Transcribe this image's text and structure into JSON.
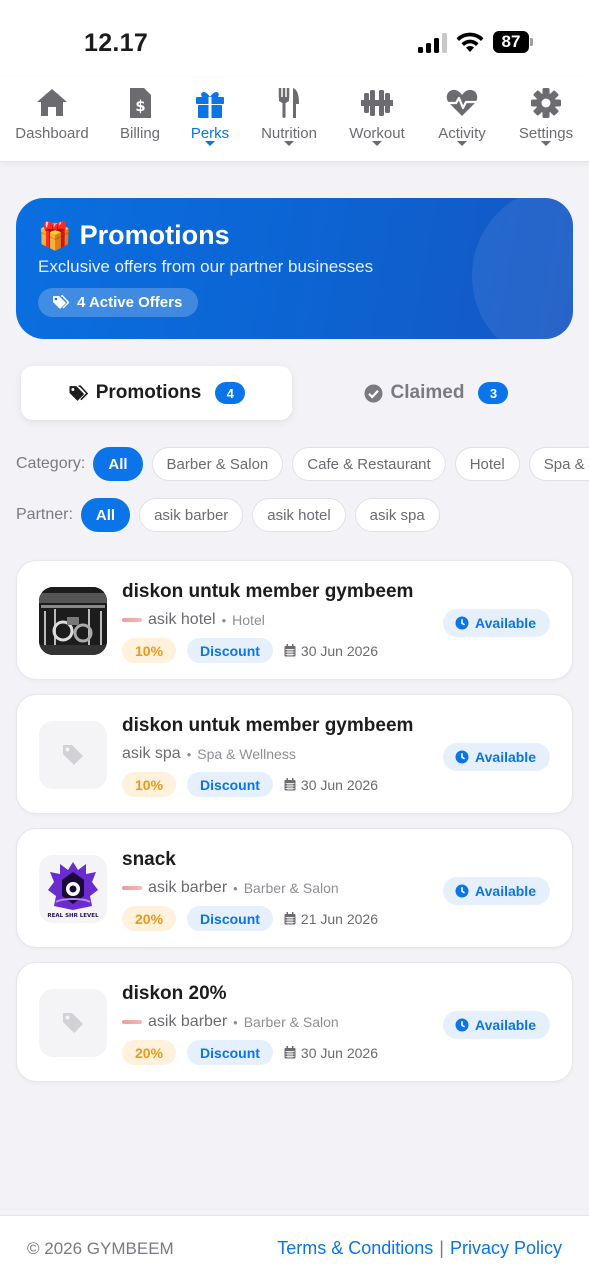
{
  "status_bar": {
    "time": "12.17",
    "battery": "87"
  },
  "nav": [
    {
      "label": "Dashboard",
      "icon": "home-icon",
      "active": false,
      "has_caret": false
    },
    {
      "label": "Billing",
      "icon": "invoice-icon",
      "active": false,
      "has_caret": false
    },
    {
      "label": "Perks",
      "icon": "gift-icon",
      "active": true,
      "has_caret": true
    },
    {
      "label": "Nutrition",
      "icon": "utensils-icon",
      "active": false,
      "has_caret": true
    },
    {
      "label": "Workout",
      "icon": "dumbbell-icon",
      "active": false,
      "has_caret": true
    },
    {
      "label": "Activity",
      "icon": "heart-pulse-icon",
      "active": false,
      "has_caret": true
    },
    {
      "label": "Settings",
      "icon": "gear-icon",
      "active": false,
      "has_caret": true
    }
  ],
  "hero": {
    "emoji": "🎁",
    "title": "Promotions",
    "subtitle": "Exclusive offers from our partner businesses",
    "badge": "4 Active Offers"
  },
  "tabs": {
    "promotions": {
      "label": "Promotions",
      "count": "4"
    },
    "claimed": {
      "label": "Claimed",
      "count": "3"
    }
  },
  "filters": {
    "category_label": "Category:",
    "categories": [
      "All",
      "Barber & Salon",
      "Cafe & Restaurant",
      "Hotel",
      "Spa & Wellness"
    ],
    "partner_label": "Partner:",
    "partners": [
      "All",
      "asik barber",
      "asik hotel",
      "asik spa"
    ]
  },
  "promotions": [
    {
      "title": "diskon untuk member gymbeem",
      "partner": "asik hotel",
      "category": "Hotel",
      "percent": "10%",
      "type": "Discount",
      "date": "30 Jun 2026",
      "status": "Available",
      "thumb": "gym-photo",
      "has_logo": true
    },
    {
      "title": "diskon untuk member gymbeem",
      "partner": "asik spa",
      "category": "Spa & Wellness",
      "percent": "10%",
      "type": "Discount",
      "date": "30 Jun 2026",
      "status": "Available",
      "thumb": "tag-placeholder",
      "has_logo": false
    },
    {
      "title": "snack",
      "partner": "asik barber",
      "category": "Barber & Salon",
      "percent": "20%",
      "type": "Discount",
      "date": "21 Jun 2026",
      "status": "Available",
      "thumb": "emblem-logo",
      "has_logo": true
    },
    {
      "title": "diskon 20%",
      "partner": "asik barber",
      "category": "Barber & Salon",
      "percent": "20%",
      "type": "Discount",
      "date": "30 Jun 2026",
      "status": "Available",
      "thumb": "tag-placeholder",
      "has_logo": true
    }
  ],
  "footer": {
    "copyright": "© 2026 GYMBEEM",
    "terms": "Terms & Conditions",
    "separator": "|",
    "privacy": "Privacy Policy"
  },
  "colors": {
    "accent": "#0a74e8",
    "percent_text": "#e99a17"
  }
}
